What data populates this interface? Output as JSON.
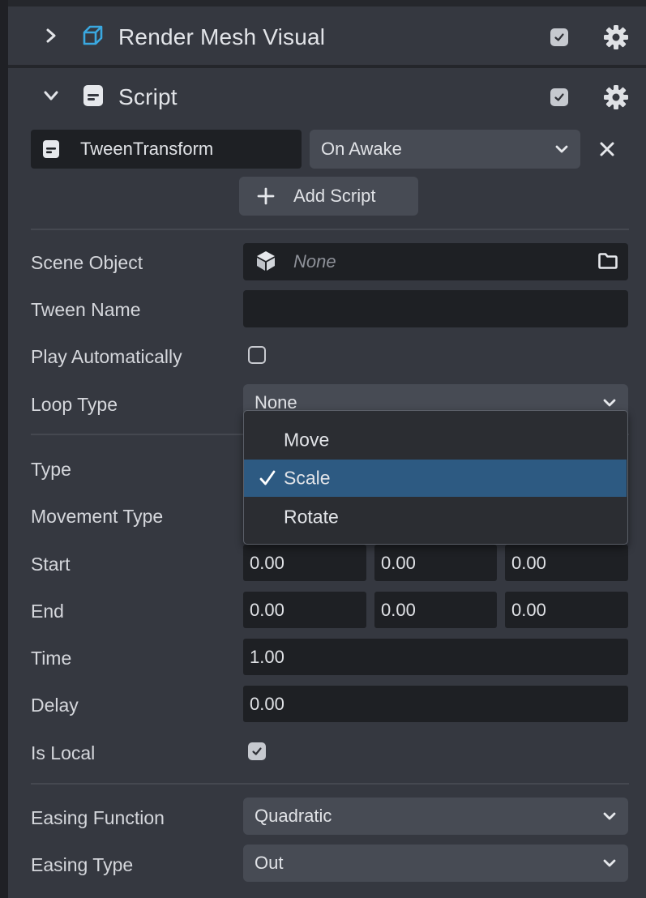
{
  "render_mesh": {
    "title": "Render Mesh Visual",
    "enabled": true
  },
  "script": {
    "title": "Script",
    "enabled": true,
    "asset_name": "TweenTransform",
    "event": "On Awake",
    "add_script_label": "Add Script"
  },
  "properties": {
    "scene_object": {
      "label": "Scene Object",
      "value": "None"
    },
    "tween_name": {
      "label": "Tween Name",
      "value": ""
    },
    "play_automatically": {
      "label": "Play Automatically",
      "checked": false
    },
    "loop_type": {
      "label": "Loop Type",
      "value": "None"
    },
    "type": {
      "label": "Type"
    },
    "movement_type": {
      "label": "Movement Type"
    },
    "start": {
      "label": "Start",
      "values": [
        "0.00",
        "0.00",
        "0.00"
      ]
    },
    "end": {
      "label": "End",
      "values": [
        "0.00",
        "0.00",
        "0.00"
      ]
    },
    "time": {
      "label": "Time",
      "value": "1.00"
    },
    "delay": {
      "label": "Delay",
      "value": "0.00"
    },
    "is_local": {
      "label": "Is Local",
      "checked": true
    },
    "easing_function": {
      "label": "Easing Function",
      "value": "Quadratic"
    },
    "easing_type": {
      "label": "Easing Type",
      "value": "Out"
    }
  },
  "type_dropdown": {
    "options": [
      "Move",
      "Scale",
      "Rotate"
    ],
    "selected": "Scale"
  },
  "colors": {
    "panel_bg": "#353840",
    "field_bg": "#1e2024",
    "select_bg": "#474b54",
    "selection": "#2d5a82",
    "accent_blue": "#3aa8e0"
  }
}
